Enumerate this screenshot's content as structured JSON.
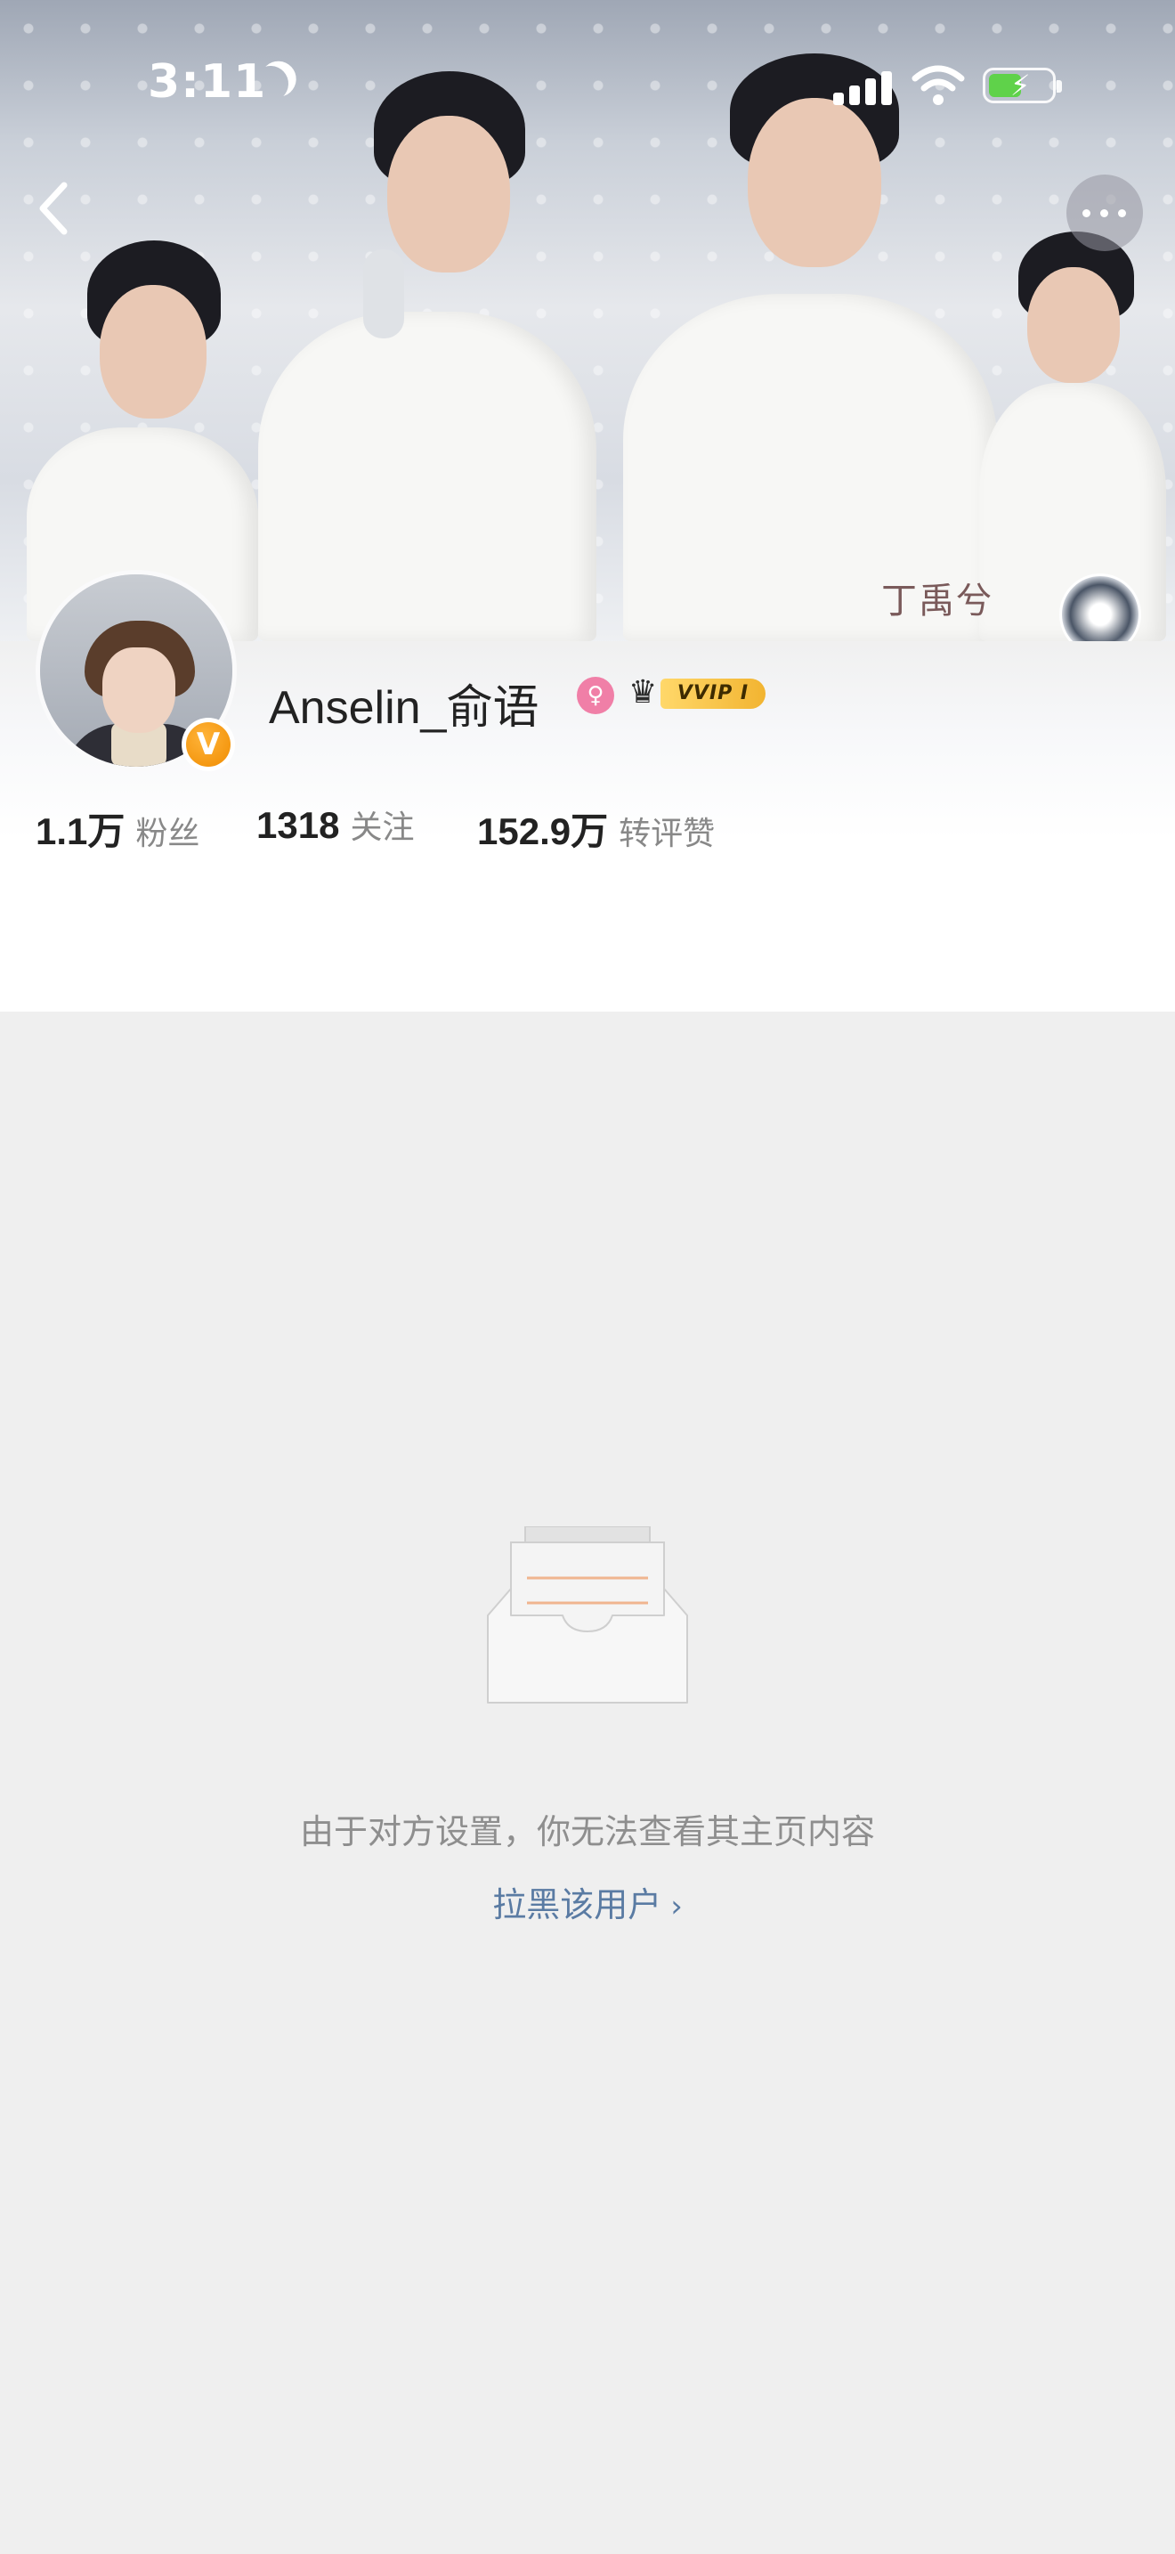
{
  "status_bar": {
    "time": "3:11",
    "icons": [
      "moon-icon",
      "signal-icon",
      "wifi-icon",
      "battery-charging-icon"
    ]
  },
  "nav": {
    "back_icon": "chevron-left-icon",
    "more_icon": "more-dots-icon"
  },
  "cover": {
    "signature_text": "丁禹兮"
  },
  "profile": {
    "username": "Anselin_俞语",
    "gender_icon": "female-icon",
    "verified_icon": "v-verified-icon",
    "vip_badge": "VVIP I",
    "stats": [
      {
        "value": "1.1万",
        "label": "粉丝"
      },
      {
        "value": "1318",
        "label": "关注"
      },
      {
        "value": "152.9万",
        "label": "转评赞"
      }
    ]
  },
  "empty_state": {
    "icon": "empty-inbox-icon",
    "message": "由于对方设置，你无法查看其主页内容",
    "block_link": "拉黑该用户"
  },
  "colors": {
    "background": "#efefef",
    "link": "#5a7ba3",
    "vip_gold": "#f2b431",
    "verified_orange": "#f08c00",
    "gender_pink": "#f07fa7"
  }
}
